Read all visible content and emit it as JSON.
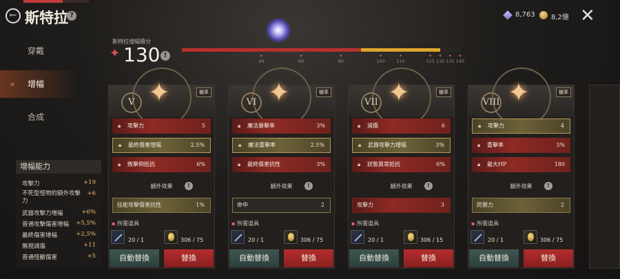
{
  "header": {
    "title": "斯特拉",
    "back_icon": "arrow-left-icon",
    "help_symbol": "?"
  },
  "currency": {
    "gems": "8,763",
    "coins": "8,2億"
  },
  "close_symbol": "✕",
  "sidebar": {
    "items": [
      {
        "label": "穿戴"
      },
      {
        "label": "增幅",
        "active": true,
        "mark": "»"
      },
      {
        "label": "合成"
      }
    ]
  },
  "score": {
    "label": "斯特拉增幅積分",
    "value": "130",
    "info_symbol": "!"
  },
  "progress": {
    "value": 130,
    "max": 140,
    "red_until": 90,
    "colors": {
      "red": "#b8312c",
      "gold": "#e0a62c"
    },
    "ticks": [
      "40",
      "60",
      "80",
      "100",
      "110",
      "125",
      "130",
      "135",
      "140"
    ]
  },
  "stats_panel": {
    "title": "增幅能力",
    "rows": [
      {
        "k": "攻擊力",
        "v": "+19"
      },
      {
        "k": "不死型怪物的額外攻擊力",
        "v": "+6"
      },
      {
        "k": "武器攻擊力增幅",
        "v": "+6%"
      },
      {
        "k": "普通攻擊傷害增幅",
        "v": "+5,5%"
      },
      {
        "k": "最終傷害增幅",
        "v": "+2,5%"
      },
      {
        "k": "無視減傷",
        "v": "+11"
      },
      {
        "k": "普通怪獸傷害",
        "v": "+5"
      }
    ]
  },
  "cards": [
    {
      "numeral": "V",
      "rate": "機率",
      "rows": [
        {
          "label": "攻擊力",
          "value": "5",
          "style": "red"
        },
        {
          "label": "最終傷害增幅",
          "value": "2.5%",
          "style": "gold"
        },
        {
          "label": "敗擊倒抵抗",
          "value": "6%",
          "style": "red"
        }
      ],
      "extra_header": "額外效果",
      "extra": {
        "label": "技能攻擊傷害抗性",
        "value": "1%",
        "style": "gold"
      },
      "req_label": "所需道具",
      "req_items": [
        {
          "count": "20 / 1"
        },
        {
          "count": "306 / 75"
        }
      ],
      "auto_label": "自動替換",
      "swap_label": "替換"
    },
    {
      "numeral": "VI",
      "rate": "機率",
      "rows": [
        {
          "label": "魔法暴擊率",
          "value": "3%",
          "style": "red"
        },
        {
          "label": "魔法重擊率",
          "value": "2.5%",
          "style": "gold"
        },
        {
          "label": "最終傷害抗性",
          "value": "3%",
          "style": "red"
        }
      ],
      "extra_header": "額外效果",
      "extra": {
        "label": "命中",
        "value": "2",
        "style": "dark"
      },
      "req_label": "所需道具",
      "req_items": [
        {
          "count": "20 / 1"
        },
        {
          "count": "306 / 75"
        }
      ],
      "auto_label": "自動替換",
      "swap_label": "替換"
    },
    {
      "numeral": "VII",
      "rate": "機率",
      "rows": [
        {
          "label": "減傷",
          "value": "6",
          "style": "red"
        },
        {
          "label": "武器攻擊力增幅",
          "value": "3%",
          "style": "gold"
        },
        {
          "label": "狀態異常抵抗",
          "value": "6%",
          "style": "red"
        }
      ],
      "extra_header": "額外效果",
      "extra": {
        "label": "攻擊力",
        "value": "3",
        "style": "red"
      },
      "req_label": "所需道具",
      "req_items": [
        {
          "count": "20 / 1"
        },
        {
          "count": "306 / 15"
        }
      ],
      "auto_label": "自動替換",
      "swap_label": "替換"
    },
    {
      "numeral": "VIII",
      "rate": "機率",
      "rows": [
        {
          "label": "攻擊力",
          "value": "4",
          "style": "gold"
        },
        {
          "label": "重擊率",
          "value": "3%",
          "style": "red"
        },
        {
          "label": "最大HP",
          "value": "180",
          "style": "red"
        }
      ],
      "extra_header": "額外效果",
      "extra": {
        "label": "防禦力",
        "value": "2",
        "style": "gold"
      },
      "req_label": "所需道具",
      "req_items": [
        {
          "count": "20 / 1"
        },
        {
          "count": "306 / 75"
        }
      ],
      "auto_label": "自動替換",
      "swap_label": "替換"
    }
  ]
}
